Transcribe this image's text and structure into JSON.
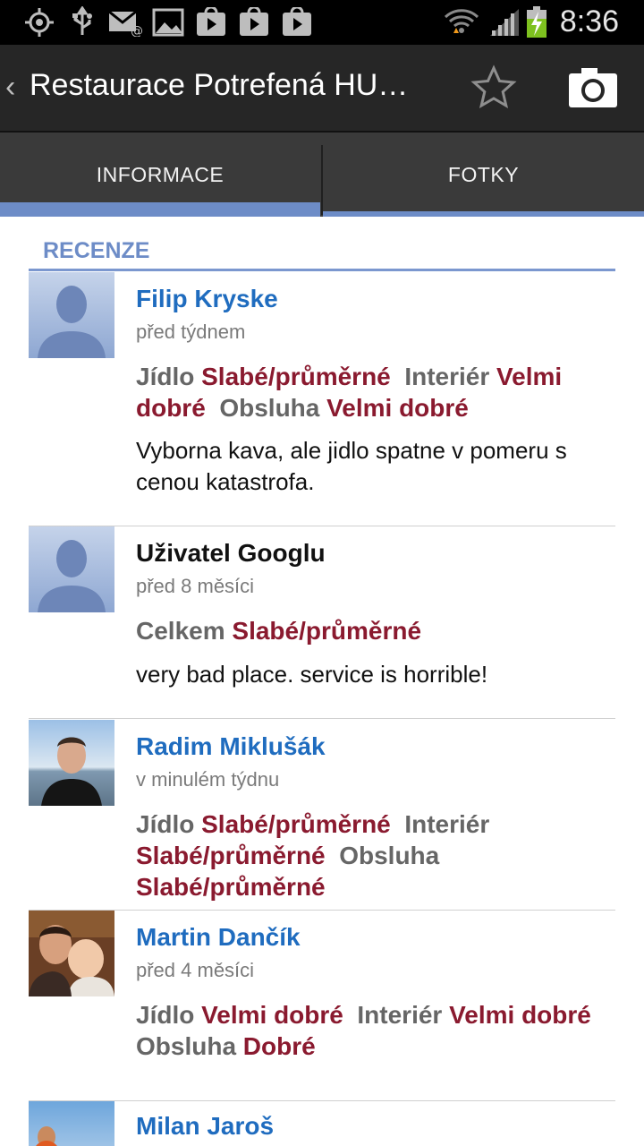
{
  "status_bar": {
    "time": "8:36",
    "left_icons": [
      "gps-icon",
      "usb-icon",
      "email-icon",
      "gallery-icon",
      "play-store-icon",
      "play-store-icon",
      "play-store-icon"
    ],
    "right_icons": [
      "wifi-icon",
      "signal-icon",
      "battery-charging-icon"
    ]
  },
  "action_bar": {
    "title": "Restaurace Potrefená HU…",
    "actions": [
      "star-icon",
      "camera-icon"
    ]
  },
  "tabs": [
    {
      "label": "INFORMACE",
      "selected": true
    },
    {
      "label": "FOTKY",
      "selected": false
    }
  ],
  "section": {
    "title": "RECENZE"
  },
  "colors": {
    "accent": "#6d8cc7",
    "name": "#1f6cbf",
    "rating_value": "#8a1a2f",
    "rating_label": "#666666"
  },
  "reviews": [
    {
      "name": "Filip Kryske",
      "time": "před týdnem",
      "avatar": "default-avatar",
      "ratings": [
        {
          "label": "Jídlo",
          "value": "Slabé/průměrné"
        },
        {
          "label": "Interiér",
          "value": "Velmi dobré"
        },
        {
          "label": "Obsluha",
          "value": "Velmi dobré"
        }
      ],
      "text": "Vyborna kava, ale jidlo spatne v pomeru s cenou katastrofa."
    },
    {
      "name": "Uživatel Googlu",
      "time": "před 8 měsíci",
      "avatar": "default-avatar",
      "ratings": [
        {
          "label": "Celkem",
          "value": "Slabé/průměrné"
        }
      ],
      "text": "very bad place. service is horrible!"
    },
    {
      "name": "Radim Miklušák",
      "time": "v minulém týdnu",
      "avatar": "photo-avatar",
      "ratings": [
        {
          "label": "Jídlo",
          "value": "Slabé/průměrné"
        },
        {
          "label": "Interiér",
          "value": "Slabé/průměrné"
        },
        {
          "label": "Obsluha",
          "value": "Slabé/průměrné"
        }
      ],
      "text": ""
    },
    {
      "name": "Martin Dančík",
      "time": "před 4 měsíci",
      "avatar": "photo-avatar",
      "ratings": [
        {
          "label": "Jídlo",
          "value": "Velmi dobré"
        },
        {
          "label": "Interiér",
          "value": "Velmi dobré"
        },
        {
          "label": "Obsluha",
          "value": "Dobré"
        }
      ],
      "text": ""
    },
    {
      "name": "Milan Jaroš",
      "time": "",
      "avatar": "photo-avatar",
      "ratings": [],
      "text": ""
    }
  ]
}
